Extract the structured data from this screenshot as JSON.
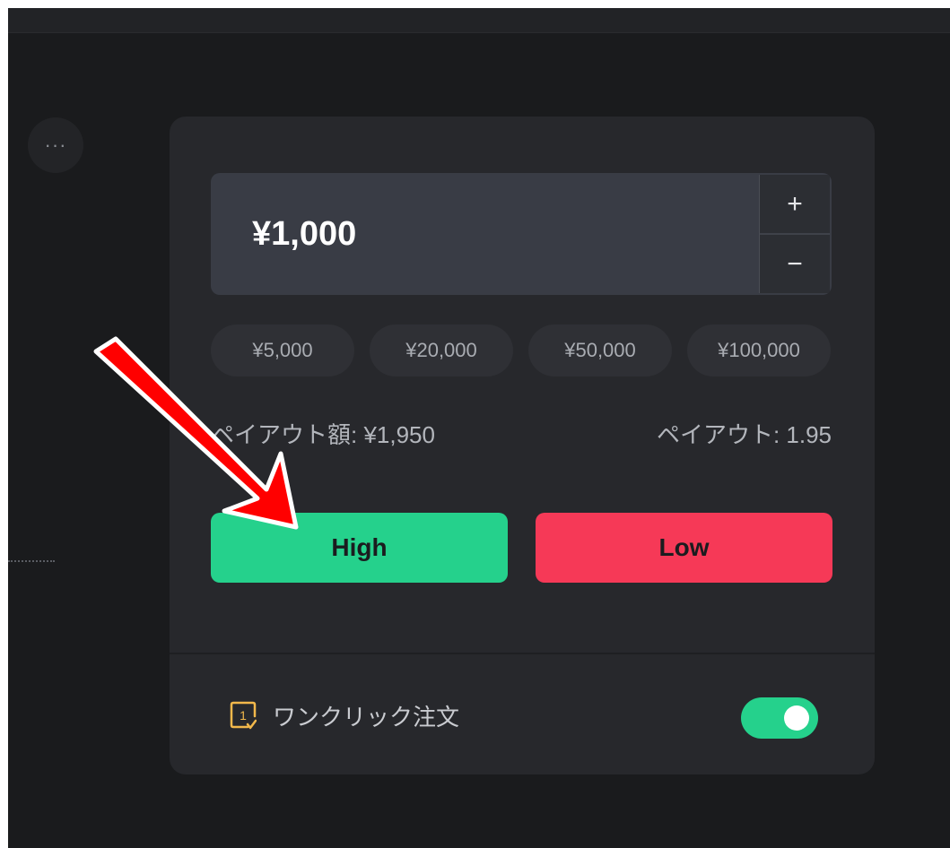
{
  "more_button": {
    "label": "···"
  },
  "trade_panel": {
    "amount": "¥1,000",
    "stepper": {
      "plus_label": "+",
      "minus_label": "−"
    },
    "presets": [
      "¥5,000",
      "¥20,000",
      "¥50,000",
      "¥100,000"
    ],
    "payout_amount": "ペイアウト額: ¥1,950",
    "payout_rate": "ペイアウト: 1.95",
    "high_label": "High",
    "low_label": "Low",
    "one_click": {
      "icon_text": "1",
      "label": "ワンクリック注文",
      "enabled": true
    }
  },
  "annotation": {
    "icon": "red-arrow",
    "color": "#ff0000",
    "points_to": "High"
  },
  "colors": {
    "high": "#25d18c",
    "low": "#f63957",
    "toggle_on": "#25d18c",
    "icon_accent": "#f2b84b"
  }
}
